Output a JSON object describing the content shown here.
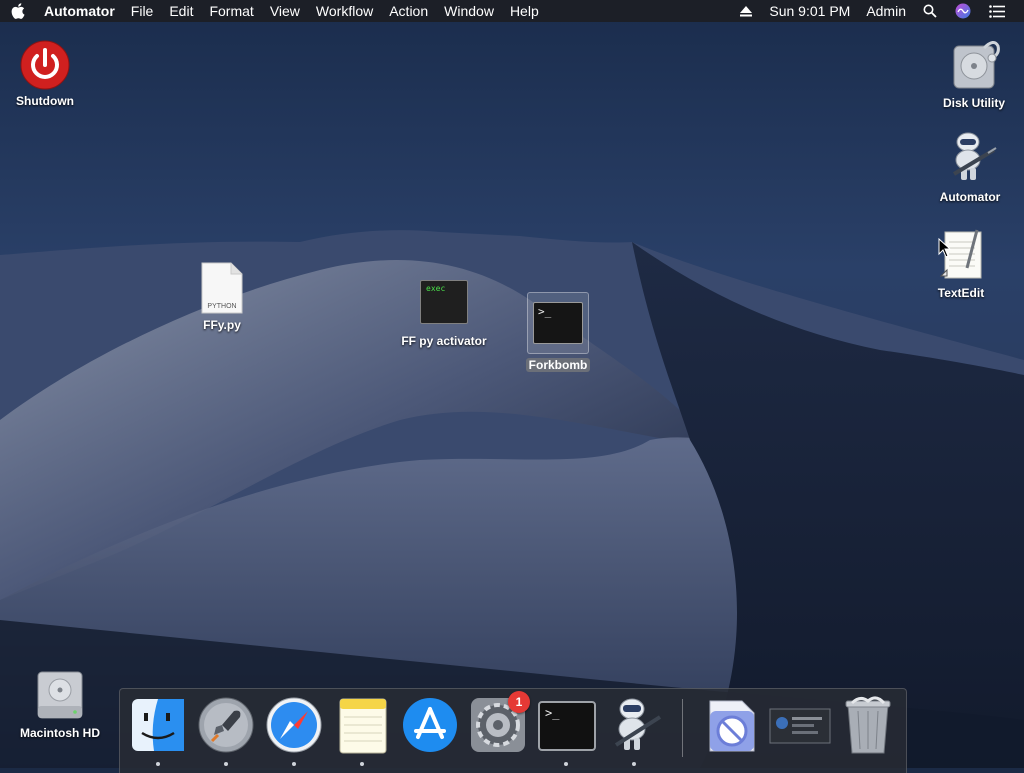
{
  "menubar": {
    "app_name": "Automator",
    "menus": [
      "File",
      "Edit",
      "Format",
      "View",
      "Workflow",
      "Action",
      "Window",
      "Help"
    ],
    "clock": "Sun 9:01 PM",
    "user": "Admin",
    "icons": [
      "apple-icon",
      "eject-icon",
      "spotlight-search-icon",
      "siri-icon",
      "notification-center-icon"
    ]
  },
  "desktop": {
    "icons": [
      {
        "label": "Shutdown",
        "icon": "power-icon"
      },
      {
        "label": "Disk Utility",
        "icon": "disk-utility-icon"
      },
      {
        "label": "Automator",
        "icon": "automator-robot-icon"
      },
      {
        "label": "TextEdit",
        "icon": "textedit-icon"
      },
      {
        "label": "FFy.py",
        "icon": "python-file-icon",
        "file_badge": "PYTHON"
      },
      {
        "label": "FF py activator",
        "icon": "exec-file-icon",
        "file_badge": "exec"
      },
      {
        "label": "Forkbomb",
        "icon": "terminal-script-icon",
        "selected": true
      },
      {
        "label": "Macintosh HD",
        "icon": "hard-drive-icon"
      }
    ]
  },
  "dock": {
    "apps": [
      {
        "name": "Finder",
        "icon": "finder-icon",
        "running": true
      },
      {
        "name": "Launchpad",
        "icon": "launchpad-icon",
        "running": true
      },
      {
        "name": "Safari",
        "icon": "safari-icon",
        "running": true
      },
      {
        "name": "Notes",
        "icon": "notes-icon",
        "running": true
      },
      {
        "name": "App Store",
        "icon": "app-store-icon",
        "running": false
      },
      {
        "name": "System Preferences",
        "icon": "system-preferences-icon",
        "running": false,
        "badge": "1"
      },
      {
        "name": "Terminal",
        "icon": "terminal-icon",
        "running": true
      },
      {
        "name": "Automator",
        "icon": "automator-icon",
        "running": true
      },
      {
        "name": "Preview",
        "icon": "preview-document-icon",
        "running": false
      },
      {
        "name": "Screen Recording",
        "icon": "screen-thumbnail-icon",
        "running": false
      },
      {
        "name": "Trash",
        "icon": "trash-icon",
        "running": false
      }
    ]
  },
  "colors": {
    "shutdown_red": "#d0201f",
    "badge_red": "#e53935",
    "menubar": "#1c1e24",
    "sky_top": "#1a2c4c",
    "selection_label": "#6b6f78"
  }
}
